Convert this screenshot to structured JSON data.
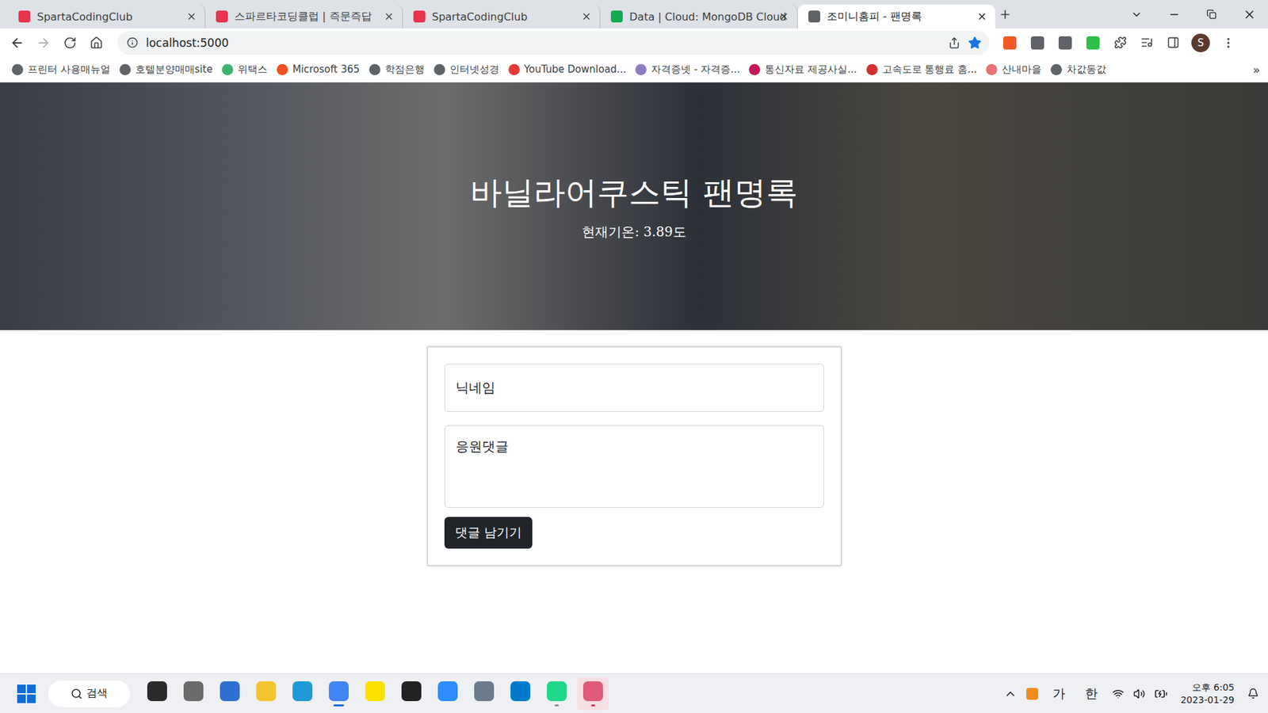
{
  "tabs": [
    {
      "label": "SpartaCodingClub",
      "selected": false,
      "color": "#e8344e"
    },
    {
      "label": "스파르타코딩클럽 | 즉문즉답",
      "selected": false,
      "color": "#e8344e"
    },
    {
      "label": "SpartaCodingClub",
      "selected": false,
      "color": "#e8344e"
    },
    {
      "label": "Data | Cloud: MongoDB Cloud",
      "selected": false,
      "color": "#13aa52"
    },
    {
      "label": "조미니홈피 - 팬명록",
      "selected": true,
      "color": "#5f6368"
    }
  ],
  "nav": {
    "back_disabled": false,
    "forward_disabled": true
  },
  "address": {
    "url": "localhost:5000",
    "bookmarked": true
  },
  "extensions": [
    {
      "color": "#f05a28"
    },
    {
      "color": "#5f6368"
    },
    {
      "color": "#5f6368"
    },
    {
      "color": "#2fbf4a"
    }
  ],
  "profile": {
    "initial": "S"
  },
  "bookmarks": [
    {
      "label": "프린터 사용매뉴얼",
      "color": "#5f6368"
    },
    {
      "label": "호텔분양매매site",
      "color": "#5f6368"
    },
    {
      "label": "위택스",
      "color": "#3cb371"
    },
    {
      "label": "Microsoft 365",
      "color": "#f25022"
    },
    {
      "label": "학점은행",
      "color": "#5f6368"
    },
    {
      "label": "인터넷성경",
      "color": "#5f6368"
    },
    {
      "label": "YouTube Download...",
      "color": "#e53935"
    },
    {
      "label": "자격증넷 - 자격증...",
      "color": "#8e7cc3"
    },
    {
      "label": "통신자료 제공사실...",
      "color": "#c2185b"
    },
    {
      "label": "고속도로 통행료 홈...",
      "color": "#d32f2f"
    },
    {
      "label": "산내마을",
      "color": "#e57373"
    },
    {
      "label": "차값동값",
      "color": "#5f6368"
    }
  ],
  "bookmarks_more": "»",
  "page": {
    "title": "바닐라어쿠스틱 팬명록",
    "weather": "현재기온: 3.89도",
    "form": {
      "nickname_placeholder": "닉네임",
      "comment_placeholder": "응원댓글",
      "submit": "댓글 남기기"
    }
  },
  "taskbar": {
    "search": "검색",
    "apps": [
      {
        "color": "#2b2b2b",
        "running": false,
        "selected": false,
        "attention": false
      },
      {
        "color": "#6b6b6b",
        "running": false,
        "selected": false,
        "attention": false
      },
      {
        "color": "#2f6fd1",
        "running": false,
        "selected": false,
        "attention": false
      },
      {
        "color": "#f4c430",
        "running": false,
        "selected": false,
        "attention": false
      },
      {
        "color": "#1e9bd7",
        "running": false,
        "selected": false,
        "attention": false
      },
      {
        "color": "#4285f4",
        "running": true,
        "selected": true,
        "attention": false
      },
      {
        "color": "#fae100",
        "running": false,
        "selected": false,
        "attention": false
      },
      {
        "color": "#222222",
        "running": false,
        "selected": false,
        "attention": false
      },
      {
        "color": "#2d8cff",
        "running": false,
        "selected": false,
        "attention": false
      },
      {
        "color": "#6b7b8c",
        "running": false,
        "selected": false,
        "attention": false
      },
      {
        "color": "#007acc",
        "running": false,
        "selected": false,
        "attention": false
      },
      {
        "color": "#21d789",
        "running": true,
        "selected": false,
        "attention": false
      },
      {
        "color": "#e05a7a",
        "running": true,
        "selected": false,
        "attention": true
      }
    ],
    "tray": {
      "input_mode": "가",
      "language": "한",
      "time": "오후 6:05",
      "date": "2023-01-29"
    }
  }
}
